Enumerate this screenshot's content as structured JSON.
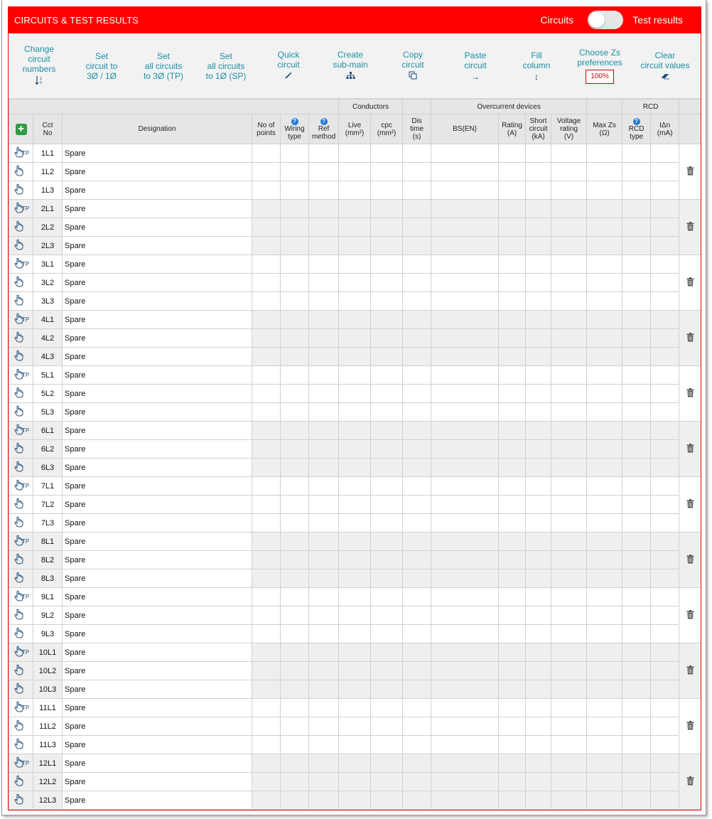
{
  "header": {
    "title": "CIRCUITS & TEST RESULTS",
    "left_toggle_label": "Circuits",
    "right_toggle_label": "Test results"
  },
  "toolbar": {
    "change_numbers": "Change\ncircuit\nnumbers",
    "set_circuit": "Set\ncircuit to\n3Ø / 1Ø",
    "set_all_tp": "Set\nall circuits\nto 3Ø (TP)",
    "set_all_sp": "Set\nall circuits\nto 1Ø (SP)",
    "quick_circuit": "Quick\ncircuit",
    "create_submain": "Create\nsub-main",
    "copy_circuit": "Copy\ncircuit",
    "paste_circuit": "Paste\ncircuit",
    "fill_column": "Fill\ncolumn",
    "choose_zs": "Choose Zs\npreferences",
    "zs_percent": "100%",
    "clear_values": "Clear\ncircuit values"
  },
  "table": {
    "group_headers": {
      "conductors": "Conductors",
      "overcurrent": "Overcurrent devices",
      "rcd": "RCD"
    },
    "columns": {
      "cct_no": "Cct\nNo",
      "designation": "Designation",
      "no_points": "No of\npoints",
      "wiring_type": "Wiring\ntype",
      "ref_method": "Ref\nmethod",
      "live": "Live\n(mm²)",
      "cpc": "cpc\n(mm²)",
      "dis_time": "Dis\ntime\n(s)",
      "bs_en": "BS(EN)",
      "rating": "Rating\n(A)",
      "short_circuit": "Short\ncircuit\n(kA)",
      "voltage_rating": "Voltage\nrating\n(V)",
      "max_zs": "Max Zs\n(Ω)",
      "rcd_type": "RCD\ntype",
      "idn": "IΔn\n(mA)"
    },
    "tp_label": "TP",
    "groups": [
      {
        "rows": [
          {
            "cct": "1L1",
            "designation": "Spare"
          },
          {
            "cct": "1L2",
            "designation": "Spare"
          },
          {
            "cct": "1L3",
            "designation": "Spare"
          }
        ]
      },
      {
        "rows": [
          {
            "cct": "2L1",
            "designation": "Spare"
          },
          {
            "cct": "2L2",
            "designation": "Spare"
          },
          {
            "cct": "2L3",
            "designation": "Spare"
          }
        ]
      },
      {
        "rows": [
          {
            "cct": "3L1",
            "designation": "Spare"
          },
          {
            "cct": "3L2",
            "designation": "Spare"
          },
          {
            "cct": "3L3",
            "designation": "Spare"
          }
        ]
      },
      {
        "rows": [
          {
            "cct": "4L1",
            "designation": "Spare"
          },
          {
            "cct": "4L2",
            "designation": "Spare"
          },
          {
            "cct": "4L3",
            "designation": "Spare"
          }
        ]
      },
      {
        "rows": [
          {
            "cct": "5L1",
            "designation": "Spare"
          },
          {
            "cct": "5L2",
            "designation": "Spare"
          },
          {
            "cct": "5L3",
            "designation": "Spare"
          }
        ]
      },
      {
        "rows": [
          {
            "cct": "6L1",
            "designation": "Spare"
          },
          {
            "cct": "6L2",
            "designation": "Spare"
          },
          {
            "cct": "6L3",
            "designation": "Spare"
          }
        ]
      },
      {
        "rows": [
          {
            "cct": "7L1",
            "designation": "Spare"
          },
          {
            "cct": "7L2",
            "designation": "Spare"
          },
          {
            "cct": "7L3",
            "designation": "Spare"
          }
        ]
      },
      {
        "rows": [
          {
            "cct": "8L1",
            "designation": "Spare"
          },
          {
            "cct": "8L2",
            "designation": "Spare"
          },
          {
            "cct": "8L3",
            "designation": "Spare"
          }
        ]
      },
      {
        "rows": [
          {
            "cct": "9L1",
            "designation": "Spare"
          },
          {
            "cct": "9L2",
            "designation": "Spare"
          },
          {
            "cct": "9L3",
            "designation": "Spare"
          }
        ]
      },
      {
        "rows": [
          {
            "cct": "10L1",
            "designation": "Spare"
          },
          {
            "cct": "10L2",
            "designation": "Spare"
          },
          {
            "cct": "10L3",
            "designation": "Spare"
          }
        ]
      },
      {
        "rows": [
          {
            "cct": "11L1",
            "designation": "Spare"
          },
          {
            "cct": "11L2",
            "designation": "Spare"
          },
          {
            "cct": "11L3",
            "designation": "Spare"
          }
        ]
      },
      {
        "rows": [
          {
            "cct": "12L1",
            "designation": "Spare"
          },
          {
            "cct": "12L2",
            "designation": "Spare"
          },
          {
            "cct": "12L3",
            "designation": "Spare"
          }
        ]
      }
    ]
  },
  "colors": {
    "header_bg": "#ff0000",
    "tool_text": "#1a8fa6",
    "add_button": "#2e9a46",
    "help_icon": "#1e7bd6"
  }
}
